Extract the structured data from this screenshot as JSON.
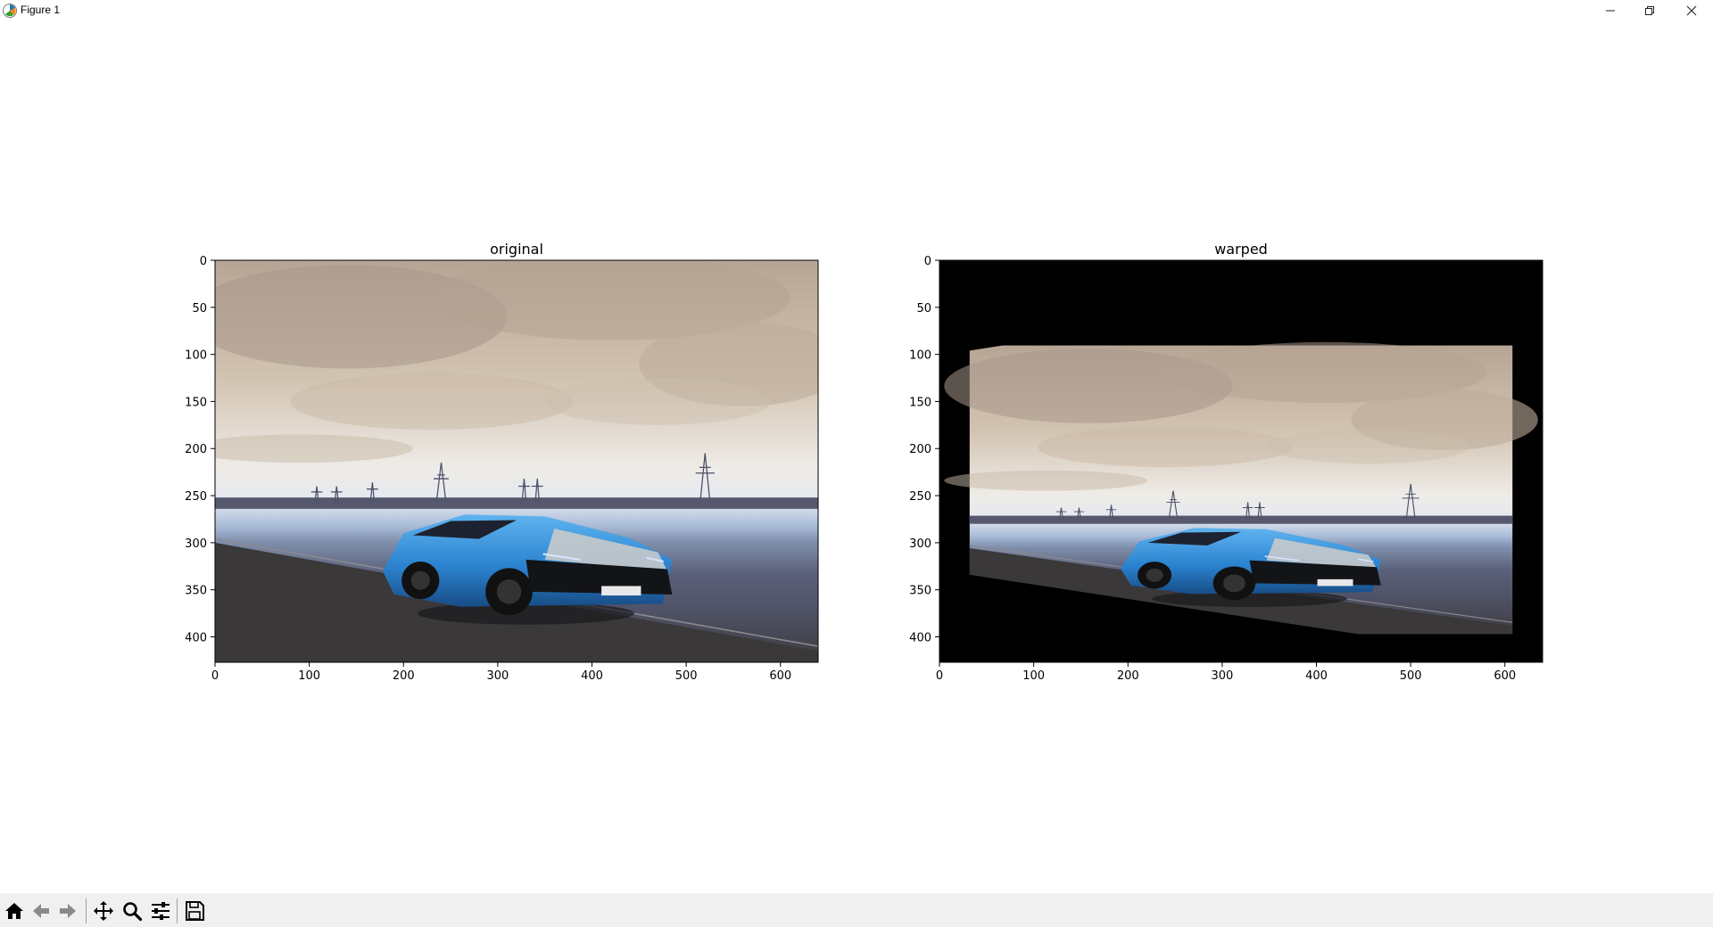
{
  "window": {
    "title": "Figure 1",
    "icon": "matplotlib-icon",
    "controls": [
      "minimize-icon",
      "restore-icon",
      "close-icon"
    ]
  },
  "chart_data": [
    {
      "type": "image",
      "title": "original",
      "xlim": [
        0,
        640
      ],
      "ylim": [
        427,
        0
      ],
      "x_ticks": [
        "0",
        "100",
        "200",
        "300",
        "400",
        "500",
        "600"
      ],
      "y_ticks": [
        "0",
        "50",
        "100",
        "150",
        "200",
        "250",
        "300",
        "350",
        "400"
      ]
    },
    {
      "type": "image",
      "title": "warped",
      "xlim": [
        0,
        640
      ],
      "ylim": [
        427,
        0
      ],
      "x_ticks": [
        "0",
        "100",
        "200",
        "300",
        "400",
        "500",
        "600"
      ],
      "y_ticks": [
        "0",
        "50",
        "100",
        "150",
        "200",
        "250",
        "300",
        "350",
        "400"
      ]
    }
  ],
  "toolbar": {
    "buttons": [
      {
        "name": "home-button",
        "icon": "home-icon"
      },
      {
        "name": "back-button",
        "icon": "arrow-left-icon"
      },
      {
        "name": "forward-button",
        "icon": "arrow-right-icon"
      },
      {
        "name": "pan-button",
        "icon": "move-icon"
      },
      {
        "name": "zoom-button",
        "icon": "magnifier-icon"
      },
      {
        "name": "configure-subplots-button",
        "icon": "sliders-icon"
      },
      {
        "name": "save-button",
        "icon": "floppy-disk-icon"
      }
    ]
  }
}
